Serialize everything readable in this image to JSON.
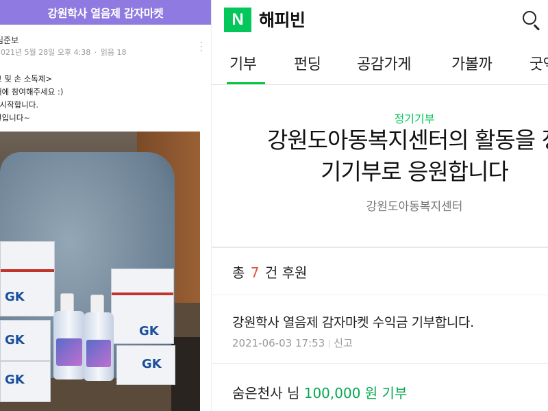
{
  "left": {
    "header_title": "강원학사 열음제 감자마켓",
    "author": "심준보",
    "date": "2021년 5월 28일 오후 4:38",
    "separator": "·",
    "views": "읽음 18",
    "body_lines": [
      "크 및 손 소독제>",
      "배에 참여해주세요 :)",
      "| 시작합니다.",
      "원입니다~"
    ],
    "photo_texts": {
      "box_logo": "GK"
    }
  },
  "right": {
    "logo_letter": "N",
    "brand": "해피빈",
    "tabs": [
      "기부",
      "펀딩",
      "공감가게",
      "가볼까",
      "굿액"
    ],
    "category": "정기기부",
    "campaign_title": "강원도아동복지센터의 활동을 정\n기기부로 응원합니다",
    "organization": "강원도아동복지센터",
    "total": {
      "prefix": "총",
      "count": "7",
      "suffix": "건 후원"
    },
    "message": {
      "text": "강원학사 열음제 감자마켓 수익금 기부합니다.",
      "datetime": "2021-06-03 17:53",
      "report": "신고"
    },
    "donor": {
      "name": "숨은천사 님",
      "amount": "100,000 원 기부"
    },
    "colors": {
      "brand_green": "#03c75a",
      "accent_red": "#e8503a",
      "header_purple": "#8e7ae0"
    }
  }
}
